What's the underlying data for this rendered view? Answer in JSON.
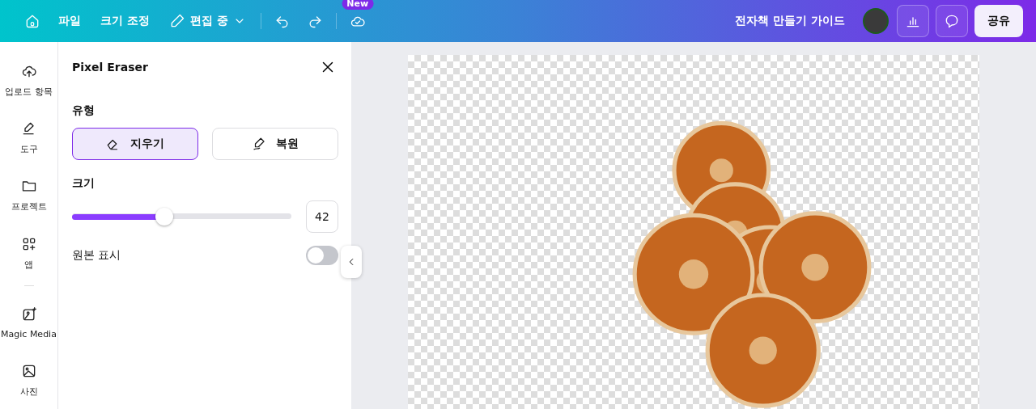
{
  "topbar": {
    "menu": [
      "파일",
      "크기 조정"
    ],
    "edit_mode": "편집 중",
    "badge": "New",
    "title": "전자책 만들기 가이드",
    "share": "공유"
  },
  "sidebar": {
    "items": [
      {
        "kind": "upload",
        "label": "업로드 항목"
      },
      {
        "kind": "tools",
        "label": "도구"
      },
      {
        "kind": "projects",
        "label": "프로젝트"
      },
      {
        "kind": "apps",
        "label": "앱"
      },
      {
        "kind": "divider"
      },
      {
        "kind": "magic",
        "label": "Magic Media"
      },
      {
        "kind": "photos",
        "label": "사진"
      }
    ]
  },
  "panel": {
    "title": "Pixel Eraser",
    "type_label": "유형",
    "modes": [
      {
        "kind": "erase",
        "label": "지우기",
        "selected": true
      },
      {
        "kind": "restore",
        "label": "복원",
        "selected": false
      }
    ],
    "size_label": "크기",
    "size": {
      "level": 0.42,
      "value": "42"
    },
    "show_original": {
      "label": "원본 표시",
      "on": false
    }
  }
}
